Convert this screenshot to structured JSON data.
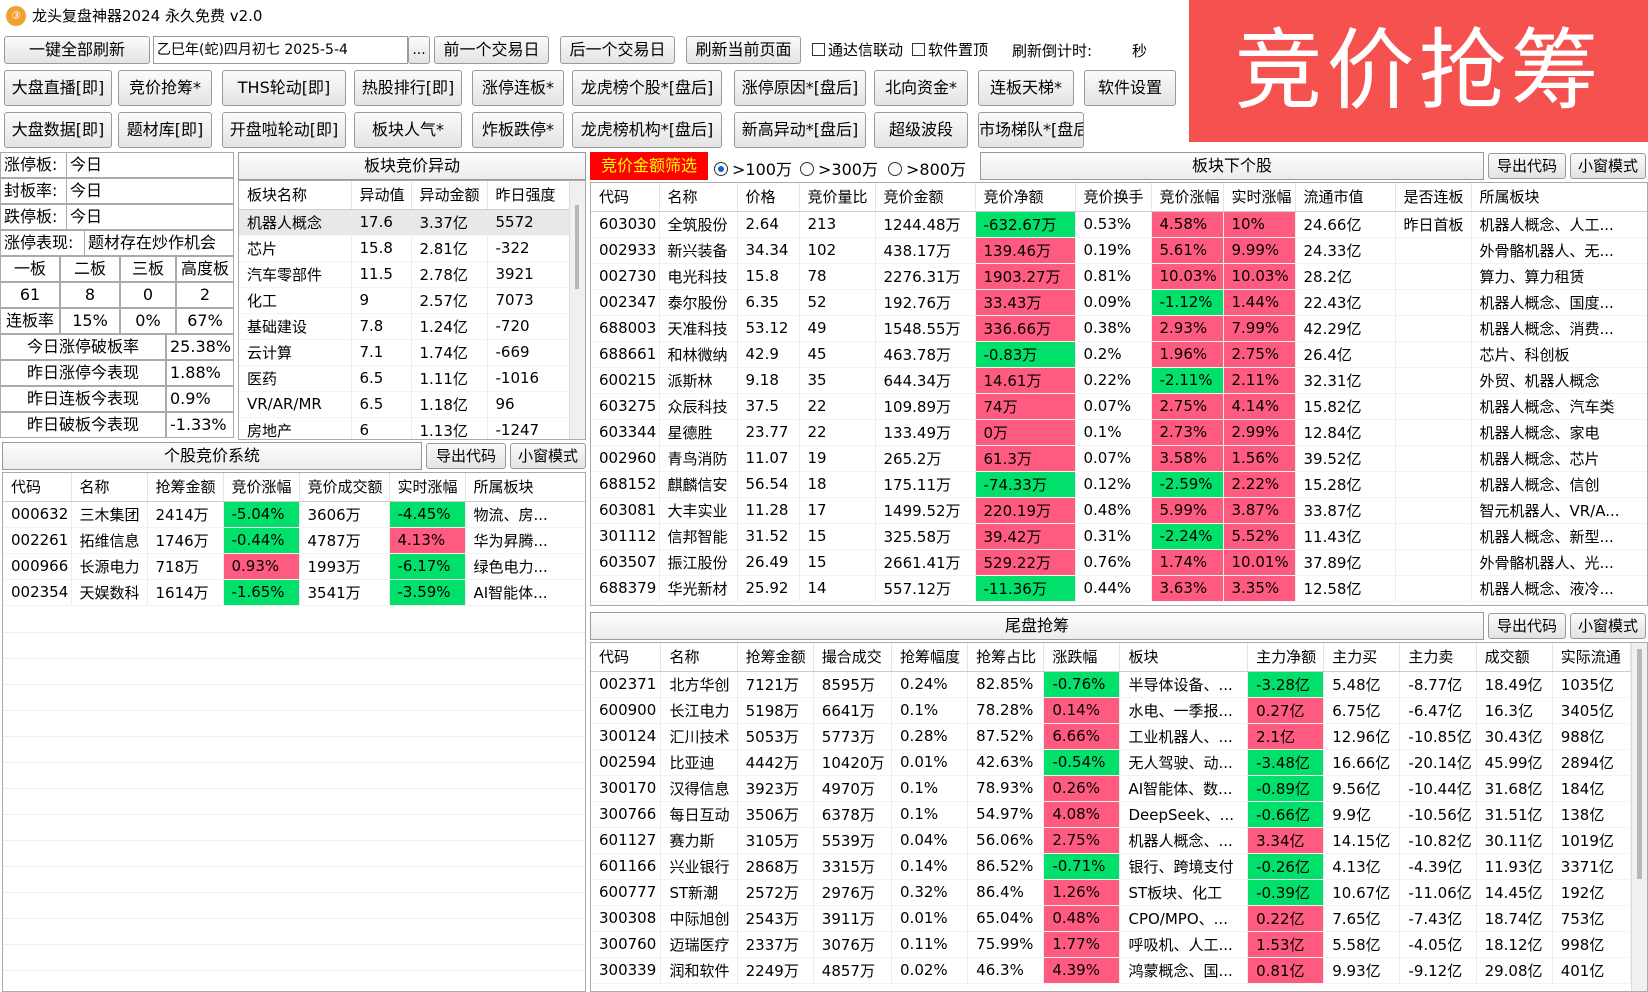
{
  "app": {
    "icon_glyph": "③",
    "title": "龙头复盘神器2024 永久免费 v2.0"
  },
  "banner": {
    "text": "竞价抢筹",
    "bg": "#f5524f"
  },
  "toolbar": {
    "refresh_all": "一键全部刷新",
    "date_value": "乙巳年(蛇)四月初七  2025-5-4",
    "date_picker": "...",
    "prev_day": "前一个交易日",
    "next_day": "后一个交易日",
    "refresh_page": "刷新当前页面",
    "tdx_link": "通达信联动",
    "pin_top": "软件置顶",
    "countdown_label": "刷新倒计时:",
    "countdown_unit": "秒"
  },
  "nav": {
    "row1": [
      "大盘直播[即]",
      "竞价抢筹*",
      "THS轮动[即]",
      "热股排行[即]",
      "涨停连板*",
      "龙虎榜个股*[盘后]",
      "涨停原因*[盘后]",
      "北向资金*",
      "连板天梯*",
      "软件设置"
    ],
    "row2": [
      "大盘数据[即]",
      "题材库[即]",
      "开盘啦轮动[即]",
      "板块人气*",
      "炸板跌停*",
      "龙虎榜机构*[盘后]",
      "新高异动*[盘后]",
      "超级波段",
      "市场梯队*[盘后]"
    ]
  },
  "market_stats": {
    "rows": [
      {
        "label": "涨停板:",
        "value": "今日"
      },
      {
        "label": "封板率:",
        "value": "今日"
      },
      {
        "label": "跌停板:",
        "value": "今日"
      }
    ],
    "perf_label": "涨停表现:",
    "perf_value": "题材存在炒作机会",
    "board_headers": [
      "一板",
      "二板",
      "三板",
      "高度板"
    ],
    "board_counts": [
      "61",
      "8",
      "0",
      "2"
    ],
    "lianban_label": "连板率",
    "lianban_values": [
      "15%",
      "0%",
      "67%"
    ],
    "summary": [
      {
        "label": "今日涨停破板率",
        "value": "25.38%"
      },
      {
        "label": "昨日涨停今表现",
        "value": "1.88%"
      },
      {
        "label": "昨日连板今表现",
        "value": "0.9%"
      },
      {
        "label": "昨日破板今表现",
        "value": "-1.33%"
      }
    ]
  },
  "sector_anomaly": {
    "title": "板块竞价异动",
    "headers": [
      "板块名称",
      "异动值",
      "异动金额",
      "昨日强度"
    ],
    "rows": [
      [
        "机器人概念",
        "17.6",
        "3.37亿",
        "5572"
      ],
      [
        "芯片",
        "15.8",
        "2.81亿",
        "-322"
      ],
      [
        "汽车零部件",
        "11.5",
        "2.78亿",
        "3921"
      ],
      [
        "化工",
        "9",
        "2.57亿",
        "7073"
      ],
      [
        "基础建设",
        "7.8",
        "1.24亿",
        "-720"
      ],
      [
        "云计算",
        "7.1",
        "1.74亿",
        "-669"
      ],
      [
        "医药",
        "6.5",
        "1.11亿",
        "-1016"
      ],
      [
        "VR/AR/MR",
        "6.5",
        "1.18亿",
        "96"
      ],
      [
        "房地产",
        "6",
        "1.13亿",
        "-1247"
      ]
    ]
  },
  "filter": {
    "label": "竞价金额筛选",
    "options": [
      ">100万",
      ">300万",
      ">800万"
    ],
    "selected": 0
  },
  "sector_stocks": {
    "title": "板块下个股",
    "export": "导出代码",
    "mini": "小窗模式",
    "headers": [
      "代码",
      "名称",
      "价格",
      "竞价量比",
      "竞价金额",
      "竞价净额",
      "竞价换手",
      "竞价涨幅",
      "实时涨幅",
      "流通市值",
      "是否连板",
      "所属板块"
    ],
    "rows": [
      [
        "603030",
        "全筑股份",
        "2.64",
        "213",
        "1244.48万",
        "-632.67万",
        "0.53%",
        "4.58%",
        "10%",
        "24.66亿",
        "昨日首板",
        "机器人概念、人工..."
      ],
      [
        "002933",
        "新兴装备",
        "34.34",
        "102",
        "438.17万",
        "139.46万",
        "0.19%",
        "5.61%",
        "9.99%",
        "24.33亿",
        "",
        "外骨骼机器人、无..."
      ],
      [
        "002730",
        "电光科技",
        "15.8",
        "78",
        "2276.31万",
        "1903.27万",
        "0.81%",
        "10.03%",
        "10.03%",
        "28.2亿",
        "",
        "算力、算力租赁"
      ],
      [
        "002347",
        "泰尔股份",
        "6.35",
        "52",
        "192.76万",
        "33.43万",
        "0.09%",
        "-1.12%",
        "1.44%",
        "22.43亿",
        "",
        "机器人概念、国度..."
      ],
      [
        "688003",
        "天准科技",
        "53.12",
        "49",
        "1548.55万",
        "336.66万",
        "0.38%",
        "2.93%",
        "7.99%",
        "42.29亿",
        "",
        "机器人概念、消费..."
      ],
      [
        "688661",
        "和林微纳",
        "42.9",
        "45",
        "463.78万",
        "-0.83万",
        "0.2%",
        "1.96%",
        "2.75%",
        "26.4亿",
        "",
        "芯片、科创板"
      ],
      [
        "600215",
        "派斯林",
        "9.18",
        "35",
        "644.34万",
        "14.61万",
        "0.22%",
        "-2.11%",
        "2.11%",
        "32.31亿",
        "",
        "外贸、机器人概念"
      ],
      [
        "603275",
        "众辰科技",
        "37.5",
        "22",
        "109.89万",
        "74万",
        "0.07%",
        "2.75%",
        "4.14%",
        "15.82亿",
        "",
        "机器人概念、汽车类"
      ],
      [
        "603344",
        "星德胜",
        "23.77",
        "22",
        "133.49万",
        "0万",
        "0.1%",
        "2.73%",
        "2.99%",
        "12.84亿",
        "",
        "机器人概念、家电"
      ],
      [
        "002960",
        "青鸟消防",
        "11.07",
        "19",
        "265.2万",
        "61.3万",
        "0.07%",
        "3.58%",
        "1.56%",
        "39.52亿",
        "",
        "机器人概念、芯片"
      ],
      [
        "688152",
        "麒麟信安",
        "56.54",
        "18",
        "175.11万",
        "-74.33万",
        "0.12%",
        "-2.59%",
        "2.22%",
        "15.28亿",
        "",
        "机器人概念、信创"
      ],
      [
        "603081",
        "大丰实业",
        "11.28",
        "17",
        "1499.52万",
        "220.19万",
        "0.48%",
        "5.99%",
        "3.87%",
        "33.87亿",
        "",
        "智元机器人、VR/A..."
      ],
      [
        "301112",
        "信邦智能",
        "31.52",
        "15",
        "325.58万",
        "39.42万",
        "0.31%",
        "-2.24%",
        "5.52%",
        "11.43亿",
        "",
        "机器人概念、新型..."
      ],
      [
        "603507",
        "振江股份",
        "26.49",
        "15",
        "2661.41万",
        "529.22万",
        "0.76%",
        "1.74%",
        "10.01%",
        "37.89亿",
        "",
        "外骨骼机器人、光..."
      ],
      [
        "688379",
        "华光新材",
        "25.92",
        "14",
        "557.12万",
        "-11.36万",
        "0.44%",
        "3.63%",
        "3.35%",
        "12.58亿",
        "",
        "机器人概念、液冷..."
      ]
    ]
  },
  "stock_bidding": {
    "title": "个股竞价系统",
    "export": "导出代码",
    "mini": "小窗模式",
    "headers": [
      "代码",
      "名称",
      "抢筹金额",
      "竞价涨幅",
      "竞价成交额",
      "实时涨幅",
      "所属板块"
    ],
    "rows": [
      [
        "000632",
        "三木集团",
        "2414万",
        "-5.04%",
        "3606万",
        "-4.45%",
        "物流、房..."
      ],
      [
        "002261",
        "拓维信息",
        "1746万",
        "-0.44%",
        "4787万",
        "4.13%",
        "华为昇腾..."
      ],
      [
        "000966",
        "长源电力",
        "718万",
        "0.93%",
        "1993万",
        "-6.17%",
        "绿色电力..."
      ],
      [
        "002354",
        "天娱数科",
        "1614万",
        "-1.65%",
        "3541万",
        "-3.59%",
        "AI智能体..."
      ]
    ]
  },
  "tail_bidding": {
    "title": "尾盘抢筹",
    "export": "导出代码",
    "mini": "小窗模式",
    "headers": [
      "代码",
      "名称",
      "抢筹金额",
      "撮合成交",
      "抢筹幅度",
      "抢筹占比",
      "涨跌幅",
      "板块",
      "主力净额",
      "主力买",
      "主力卖",
      "成交额",
      "实际流通"
    ],
    "rows": [
      [
        "002371",
        "北方华创",
        "7121万",
        "8595万",
        "0.24%",
        "82.85%",
        "-0.76%",
        "半导体设备、...",
        "-3.28亿",
        "5.48亿",
        "-8.77亿",
        "18.49亿",
        "1035亿"
      ],
      [
        "600900",
        "长江电力",
        "5198万",
        "6641万",
        "0.1%",
        "78.28%",
        "0.14%",
        "水电、一季报...",
        "0.27亿",
        "6.75亿",
        "-6.47亿",
        "16.3亿",
        "3405亿"
      ],
      [
        "300124",
        "汇川技术",
        "5053万",
        "5773万",
        "0.28%",
        "87.52%",
        "6.66%",
        "工业机器人、...",
        "2.1亿",
        "12.96亿",
        "-10.85亿",
        "30.43亿",
        "988亿"
      ],
      [
        "002594",
        "比亚迪",
        "4442万",
        "10420万",
        "0.01%",
        "42.63%",
        "-0.54%",
        "无人驾驶、动...",
        "-3.48亿",
        "16.66亿",
        "-20.14亿",
        "45.99亿",
        "2894亿"
      ],
      [
        "300170",
        "汉得信息",
        "3923万",
        "4970万",
        "0.1%",
        "78.93%",
        "0.26%",
        "AI智能体、数...",
        "-0.89亿",
        "9.56亿",
        "-10.44亿",
        "31.68亿",
        "184亿"
      ],
      [
        "300766",
        "每日互动",
        "3506万",
        "6378万",
        "0.1%",
        "54.97%",
        "4.08%",
        "DeepSeek、...",
        "-0.66亿",
        "9.9亿",
        "-10.56亿",
        "31.51亿",
        "138亿"
      ],
      [
        "601127",
        "赛力斯",
        "3105万",
        "5539万",
        "0.04%",
        "56.06%",
        "2.75%",
        "机器人概念、...",
        "3.34亿",
        "14.15亿",
        "-10.82亿",
        "30.11亿",
        "1019亿"
      ],
      [
        "601166",
        "兴业银行",
        "2868万",
        "3315万",
        "0.14%",
        "86.52%",
        "-0.71%",
        "银行、跨境支付",
        "-0.26亿",
        "4.13亿",
        "-4.39亿",
        "11.93亿",
        "3371亿"
      ],
      [
        "600777",
        "ST新潮",
        "2572万",
        "2976万",
        "0.32%",
        "86.4%",
        "1.26%",
        "ST板块、化工",
        "-0.39亿",
        "10.67亿",
        "-11.06亿",
        "14.45亿",
        "192亿"
      ],
      [
        "300308",
        "中际旭创",
        "2543万",
        "3911万",
        "0.01%",
        "65.04%",
        "0.48%",
        "CPO/MPO、...",
        "0.22亿",
        "7.65亿",
        "-7.43亿",
        "18.74亿",
        "753亿"
      ],
      [
        "300760",
        "迈瑞医疗",
        "2337万",
        "3076万",
        "0.11%",
        "75.99%",
        "1.77%",
        "呼吸机、人工...",
        "1.53亿",
        "5.58亿",
        "-4.05亿",
        "18.12亿",
        "998亿"
      ],
      [
        "300339",
        "润和软件",
        "2249万",
        "4857万",
        "0.02%",
        "46.3%",
        "4.39%",
        "鸿蒙概念、国...",
        "0.81亿",
        "9.93亿",
        "-9.12亿",
        "29.08亿",
        "401亿"
      ]
    ]
  },
  "colors": {
    "up": "#ff5a80",
    "down": "#00e06a",
    "filter_bg": "#ff0000",
    "filter_fg": "#ffff00"
  }
}
